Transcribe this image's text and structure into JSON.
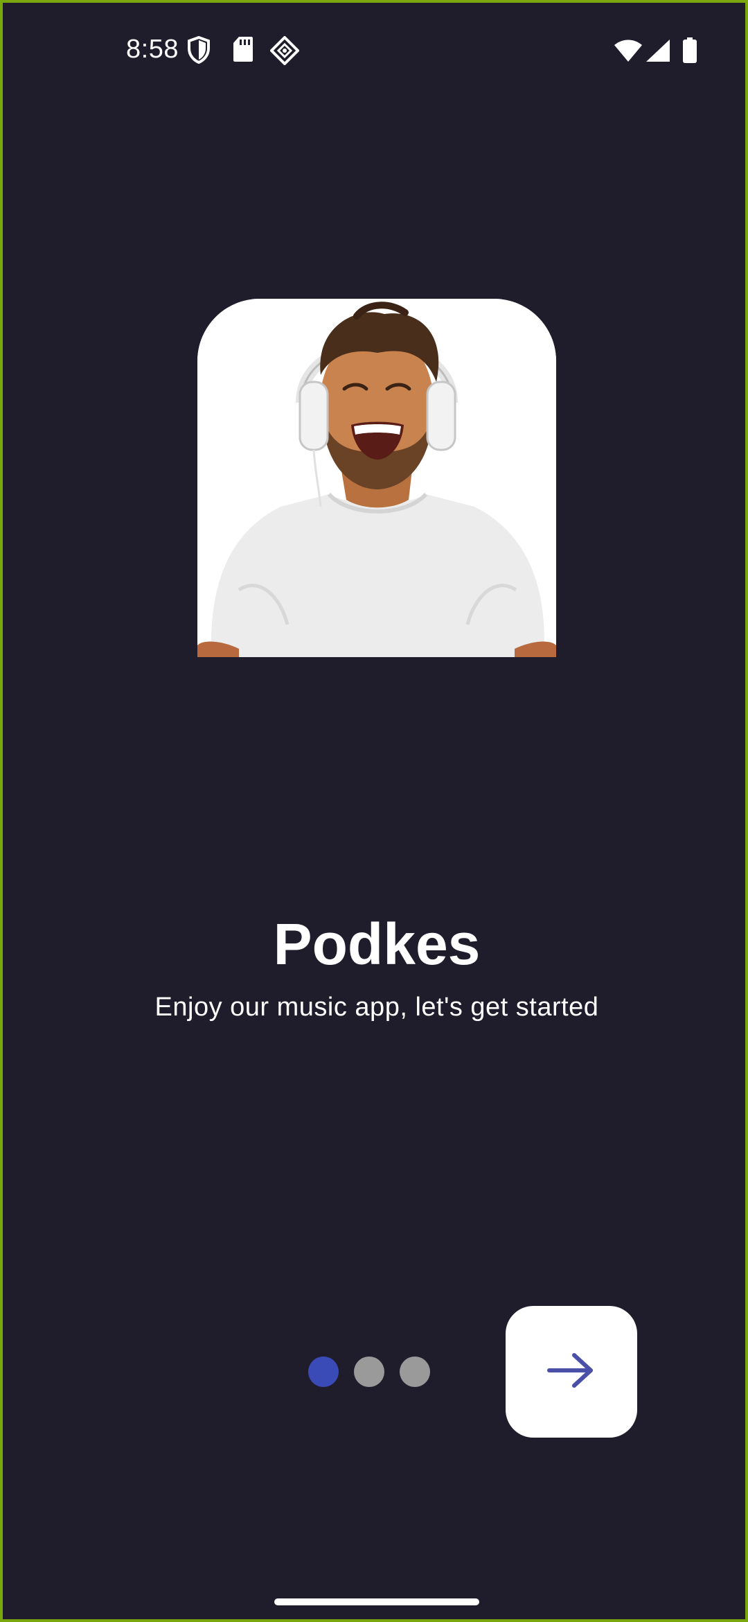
{
  "status_bar": {
    "time": "8:58",
    "icons": [
      "shield-icon",
      "sd-card-icon",
      "diamond-app-icon",
      "wifi-icon",
      "cellular-signal-icon",
      "battery-icon"
    ]
  },
  "onboarding": {
    "hero_image": "man-with-headphones-laughing",
    "title": "Podkes",
    "subtitle": "Enjoy our music app, let's get started",
    "pager": {
      "total_pages": 3,
      "current_page": 1
    },
    "next_button_icon": "arrow-right-icon"
  },
  "colors": {
    "background": "#1f1c2c",
    "dot_active": "#3a4bb8",
    "dot_inactive": "#9a9a9a",
    "arrow": "#4a4fa8",
    "frame_border": "#7aa60e"
  }
}
